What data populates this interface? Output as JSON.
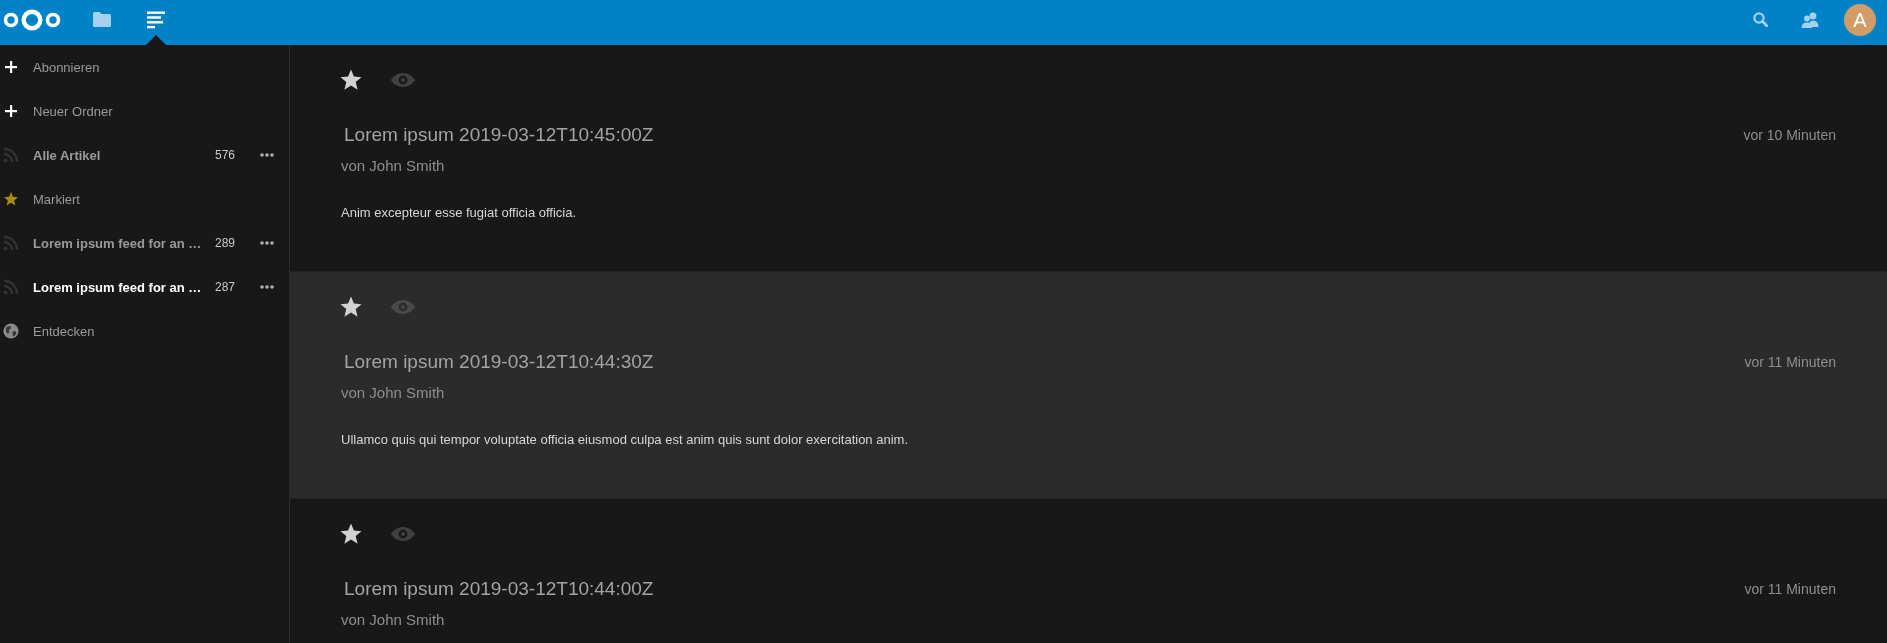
{
  "header": {
    "apps": [
      {
        "kind": "files",
        "selected": false
      },
      {
        "kind": "news",
        "selected": true
      }
    ],
    "avatar": {
      "initial": "A"
    }
  },
  "sidebar": {
    "items": [
      {
        "kind": "add",
        "label": "Abonnieren",
        "selected": false
      },
      {
        "kind": "add",
        "label": "Neuer Ordner",
        "selected": false
      },
      {
        "kind": "all",
        "label": "Alle Artikel",
        "count": "576",
        "selected": false
      },
      {
        "kind": "starred",
        "label": "Markiert",
        "selected": false
      },
      {
        "kind": "feed",
        "label": "Lorem ipsum feed for an …",
        "count": "289",
        "selected": false
      },
      {
        "kind": "feed",
        "label": "Lorem ipsum feed for an …",
        "count": "287",
        "selected": true
      },
      {
        "kind": "explore",
        "label": "Entdecken",
        "selected": false
      }
    ]
  },
  "articles": [
    {
      "title": "Lorem ipsum 2019-03-12T10:45:00Z",
      "author": "von John Smith",
      "time": "vor 10 Minuten",
      "body": "Anim excepteur esse fugiat officia officia.",
      "selected": false
    },
    {
      "title": "Lorem ipsum 2019-03-12T10:44:30Z",
      "author": "von John Smith",
      "time": "vor 11 Minuten",
      "body": "Ullamco quis qui tempor voluptate officia eiusmod culpa est anim quis sunt dolor exercitation anim.",
      "selected": true
    },
    {
      "title": "Lorem ipsum 2019-03-12T10:44:00Z",
      "author": "von John Smith",
      "time": "vor 11 Minuten",
      "selected": false
    }
  ]
}
